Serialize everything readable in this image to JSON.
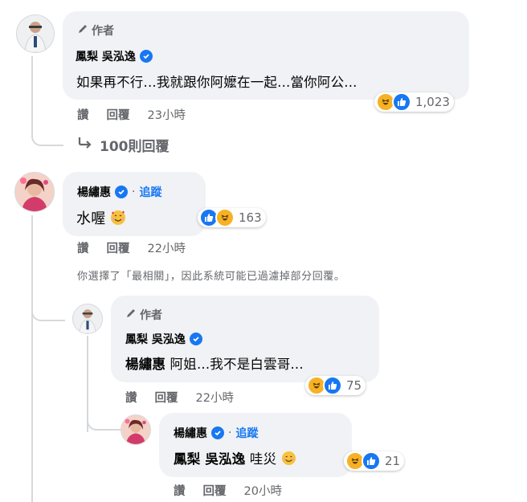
{
  "thread": [
    {
      "author_badge": "作者",
      "name": "鳳梨 吳泓逸",
      "text": "如果再不行...我就跟你阿嬤在一起...當你阿公...",
      "actions": {
        "like": "讚",
        "reply": "回覆",
        "time": "23小時"
      },
      "reaction_count": "1,023"
    }
  ],
  "replies_link": "100則回覆",
  "second": {
    "name": "楊繡惠",
    "follow": "追蹤",
    "text": "水喔",
    "actions": {
      "like": "讚",
      "reply": "回覆",
      "time": "22小時"
    },
    "reaction_count": "163"
  },
  "notice": "你選擇了「最相關」，因此系統可能已過濾掉部分回覆。",
  "reply1": {
    "author_badge": "作者",
    "name": "鳳梨 吳泓逸",
    "mention": "楊繡惠",
    "text": " 阿姐...我不是白雲哥...",
    "actions": {
      "like": "讚",
      "reply": "回覆",
      "time": "22小時"
    },
    "reaction_count": "75"
  },
  "reply2": {
    "name": "楊繡惠",
    "follow": "追蹤",
    "mention": "鳳梨 吳泓逸",
    "text": " 哇災",
    "actions": {
      "like": "讚",
      "reply": "回覆",
      "time": "20小時"
    },
    "reaction_count": "21"
  },
  "colors": {
    "link": "#1877f2",
    "bubble": "#f0f2f5",
    "muted": "#65676b",
    "haha": "#f7b125"
  }
}
